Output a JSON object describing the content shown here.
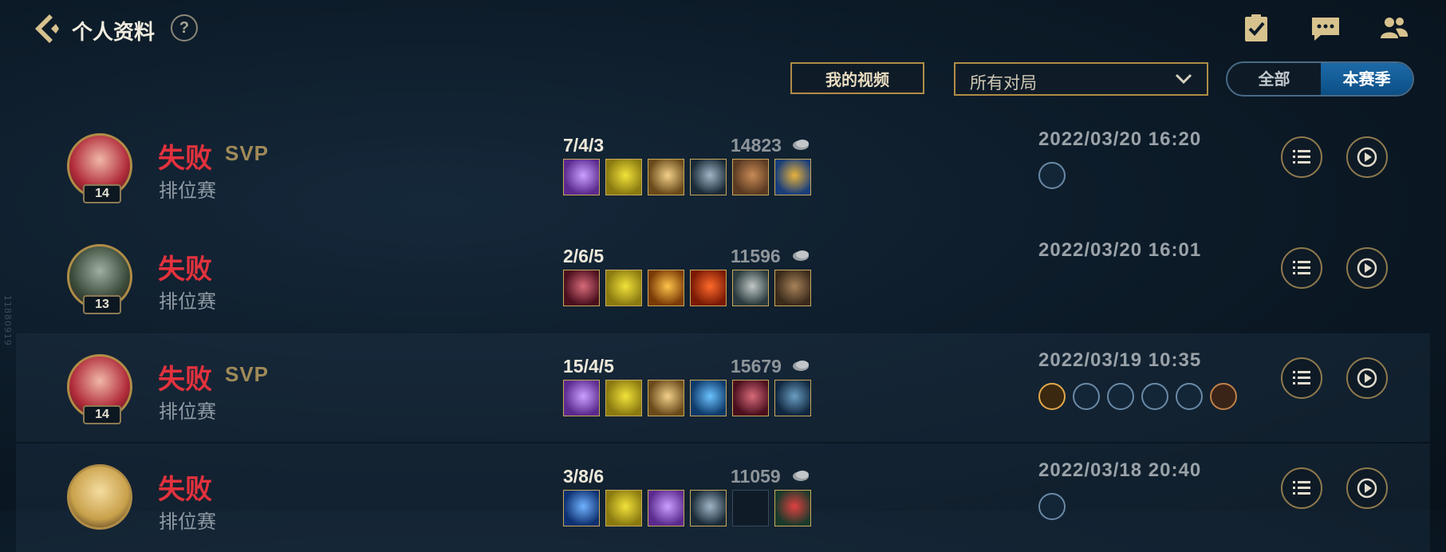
{
  "header": {
    "title": "个人资料",
    "help_label": "?",
    "icons": [
      "back-icon",
      "help-icon",
      "clipboard-check-icon",
      "chat-icon",
      "friends-icon"
    ]
  },
  "toolbar": {
    "my_videos_label": "我的视频",
    "filter_selected": "所有对局",
    "toggle_options": [
      "全部",
      "本赛季"
    ],
    "toggle_selected": "本赛季"
  },
  "side_id": "11880919",
  "matches": [
    {
      "level": "14",
      "result": "失败",
      "tag": "SVP",
      "mode": "排位赛",
      "kda": "7/4/3",
      "gold": "14823",
      "datetime": "2022/03/20 16:20",
      "items": [
        "purple-dagger-item",
        "yellow-shield-item",
        "winged-blade-item",
        "steel-spear-item",
        "hammer-item",
        "trinket-item"
      ],
      "badges": [
        "rune-badge"
      ]
    },
    {
      "level": "13",
      "result": "失败",
      "tag": "",
      "mode": "排位赛",
      "kda": "2/6/5",
      "gold": "11596",
      "datetime": "2022/03/20 16:01",
      "items": [
        "crimson-blade-item",
        "yellow-shield-item",
        "sun-staff-item",
        "fire-orb-item",
        "greatsword-item",
        "boots-item"
      ],
      "badges": []
    },
    {
      "level": "14",
      "result": "失败",
      "tag": "SVP",
      "mode": "排位赛",
      "kda": "15/4/5",
      "gold": "15679",
      "datetime": "2022/03/19 10:35",
      "items": [
        "purple-dagger-item",
        "yellow-shield-item",
        "winged-blade-item",
        "ice-lance-item",
        "crimson-blade-item",
        "frost-boots-item"
      ],
      "badges": [
        "a-rank-badge",
        "three-kill-badge",
        "flag-badge",
        "sword-badge",
        "crown-badge",
        "gold-badge"
      ]
    },
    {
      "level": "",
      "result": "失败",
      "tag": "",
      "mode": "排位赛",
      "kda": "3/8/6",
      "gold": "11059",
      "datetime": "2022/03/18 20:40",
      "items": [
        "blue-blade-item",
        "yellow-shield-item",
        "purple-dagger-item",
        "steel-spear-item",
        "empty-slot-item",
        "potion-item"
      ],
      "badges": [
        "rune-badge"
      ]
    }
  ],
  "colors": {
    "defeat": "#e2323d",
    "gold_border": "#b08d47",
    "toggle_active": "#1c6aa8",
    "background": "#0c1a27"
  }
}
